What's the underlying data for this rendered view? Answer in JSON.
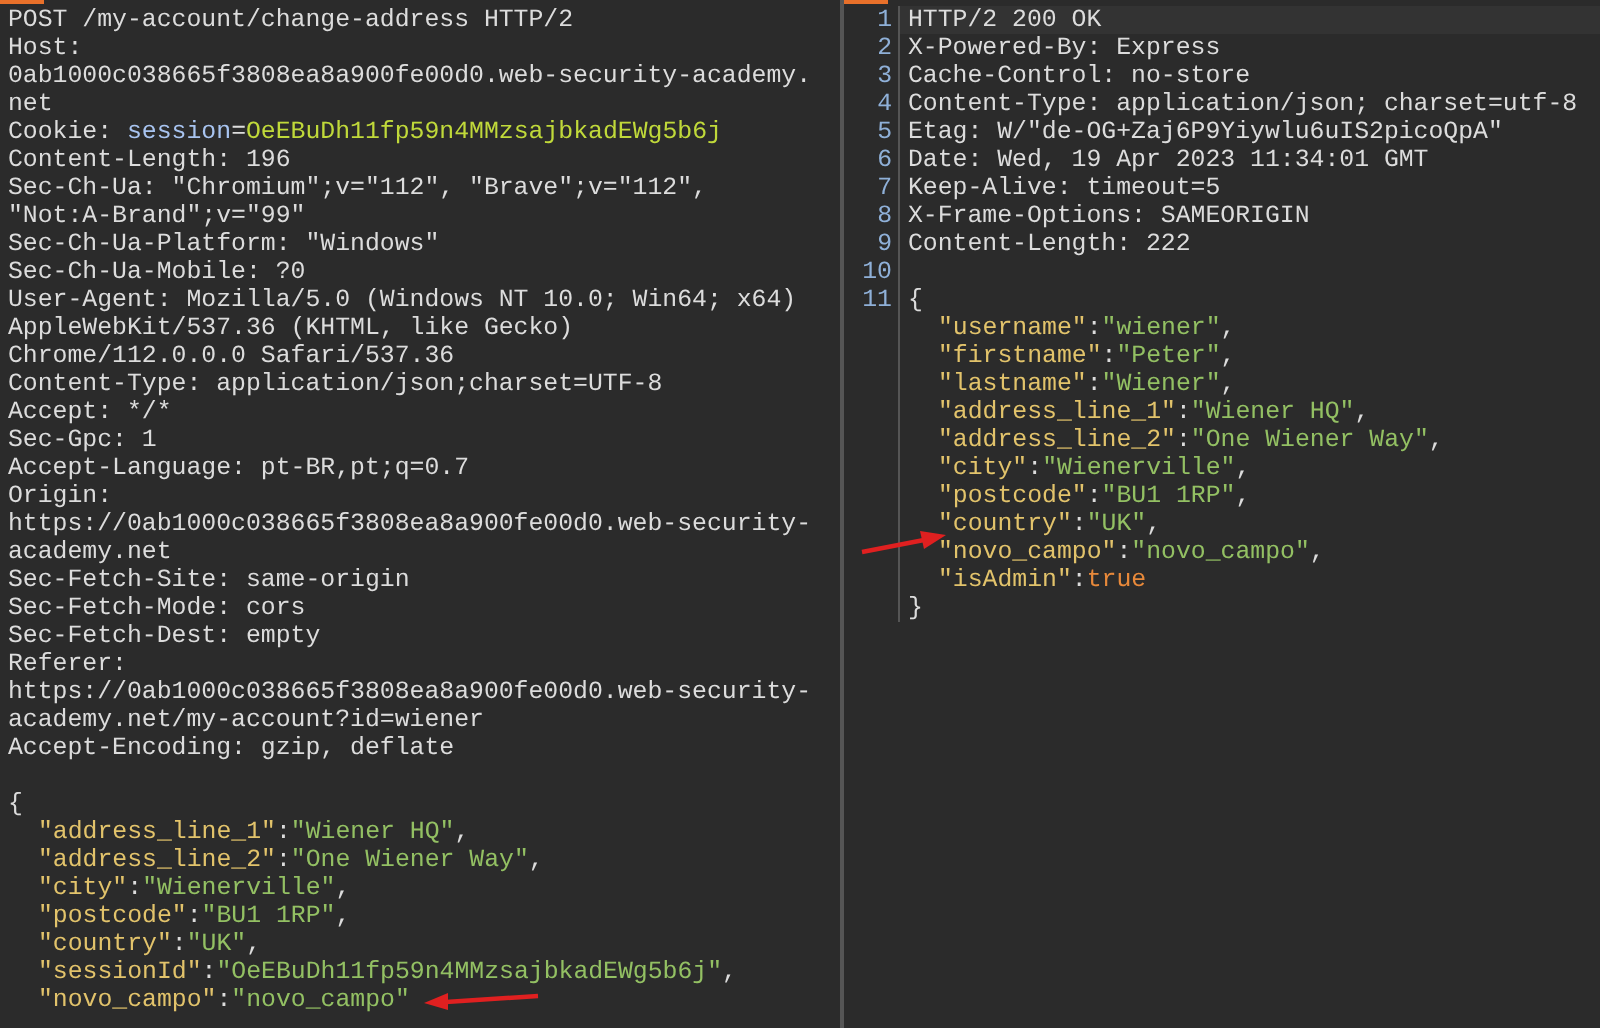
{
  "request": {
    "lines": [
      {
        "segments": [
          {
            "kind": "plain",
            "text": "POST /my-account/change-address HTTP/2"
          }
        ]
      },
      {
        "segments": [
          {
            "kind": "plain",
            "text": "Host:"
          }
        ]
      },
      {
        "segments": [
          {
            "kind": "plain",
            "text": "0ab1000c038665f3808ea8a900fe00d0.web-security-academy."
          }
        ]
      },
      {
        "segments": [
          {
            "kind": "plain",
            "text": "net"
          }
        ]
      },
      {
        "segments": [
          {
            "kind": "plain",
            "text": "Cookie: "
          },
          {
            "kind": "cookie_name",
            "text": "session"
          },
          {
            "kind": "plain",
            "text": "="
          },
          {
            "kind": "cookie_value",
            "text": "OeEBuDh11fp59n4MMzsajbkadEWg5b6j"
          }
        ]
      },
      {
        "segments": [
          {
            "kind": "plain",
            "text": "Content-Length: 196"
          }
        ]
      },
      {
        "segments": [
          {
            "kind": "plain",
            "text": "Sec-Ch-Ua: \"Chromium\";v=\"112\", \"Brave\";v=\"112\","
          }
        ]
      },
      {
        "segments": [
          {
            "kind": "plain",
            "text": "\"Not:A-Brand\";v=\"99\""
          }
        ]
      },
      {
        "segments": [
          {
            "kind": "plain",
            "text": "Sec-Ch-Ua-Platform: \"Windows\""
          }
        ]
      },
      {
        "segments": [
          {
            "kind": "plain",
            "text": "Sec-Ch-Ua-Mobile: ?0"
          }
        ]
      },
      {
        "segments": [
          {
            "kind": "plain",
            "text": "User-Agent: Mozilla/5.0 (Windows NT 10.0; Win64; x64)"
          }
        ]
      },
      {
        "segments": [
          {
            "kind": "plain",
            "text": "AppleWebKit/537.36 (KHTML, like Gecko)"
          }
        ]
      },
      {
        "segments": [
          {
            "kind": "plain",
            "text": "Chrome/112.0.0.0 Safari/537.36"
          }
        ]
      },
      {
        "segments": [
          {
            "kind": "plain",
            "text": "Content-Type: application/json;charset=UTF-8"
          }
        ]
      },
      {
        "segments": [
          {
            "kind": "plain",
            "text": "Accept: */*"
          }
        ]
      },
      {
        "segments": [
          {
            "kind": "plain",
            "text": "Sec-Gpc: 1"
          }
        ]
      },
      {
        "segments": [
          {
            "kind": "plain",
            "text": "Accept-Language: pt-BR,pt;q=0.7"
          }
        ]
      },
      {
        "segments": [
          {
            "kind": "plain",
            "text": "Origin:"
          }
        ]
      },
      {
        "segments": [
          {
            "kind": "plain",
            "text": "https://0ab1000c038665f3808ea8a900fe00d0.web-security-"
          }
        ]
      },
      {
        "segments": [
          {
            "kind": "plain",
            "text": "academy.net"
          }
        ]
      },
      {
        "segments": [
          {
            "kind": "plain",
            "text": "Sec-Fetch-Site: same-origin"
          }
        ]
      },
      {
        "segments": [
          {
            "kind": "plain",
            "text": "Sec-Fetch-Mode: cors"
          }
        ]
      },
      {
        "segments": [
          {
            "kind": "plain",
            "text": "Sec-Fetch-Dest: empty"
          }
        ]
      },
      {
        "segments": [
          {
            "kind": "plain",
            "text": "Referer:"
          }
        ]
      },
      {
        "segments": [
          {
            "kind": "plain",
            "text": "https://0ab1000c038665f3808ea8a900fe00d0.web-security-"
          }
        ]
      },
      {
        "segments": [
          {
            "kind": "plain",
            "text": "academy.net/my-account?id=wiener"
          }
        ]
      },
      {
        "segments": [
          {
            "kind": "plain",
            "text": "Accept-Encoding: gzip, deflate"
          }
        ]
      },
      {
        "gap_before": true,
        "segments": [
          {
            "kind": "plain",
            "text": "{"
          }
        ]
      },
      {
        "indent": true,
        "segments": [
          {
            "kind": "key",
            "text": "\"address_line_1\""
          },
          {
            "kind": "plain",
            "text": ":"
          },
          {
            "kind": "string",
            "text": "\"Wiener HQ\""
          },
          {
            "kind": "plain",
            "text": ","
          }
        ]
      },
      {
        "indent": true,
        "segments": [
          {
            "kind": "key",
            "text": "\"address_line_2\""
          },
          {
            "kind": "plain",
            "text": ":"
          },
          {
            "kind": "string",
            "text": "\"One Wiener Way\""
          },
          {
            "kind": "plain",
            "text": ","
          }
        ]
      },
      {
        "indent": true,
        "segments": [
          {
            "kind": "key",
            "text": "\"city\""
          },
          {
            "kind": "plain",
            "text": ":"
          },
          {
            "kind": "string",
            "text": "\"Wienerville\""
          },
          {
            "kind": "plain",
            "text": ","
          }
        ]
      },
      {
        "indent": true,
        "segments": [
          {
            "kind": "key",
            "text": "\"postcode\""
          },
          {
            "kind": "plain",
            "text": ":"
          },
          {
            "kind": "string",
            "text": "\"BU1 1RP\""
          },
          {
            "kind": "plain",
            "text": ","
          }
        ]
      },
      {
        "indent": true,
        "segments": [
          {
            "kind": "key",
            "text": "\"country\""
          },
          {
            "kind": "plain",
            "text": ":"
          },
          {
            "kind": "string",
            "text": "\"UK\""
          },
          {
            "kind": "plain",
            "text": ","
          }
        ]
      },
      {
        "indent": true,
        "segments": [
          {
            "kind": "key",
            "text": "\"sessionId\""
          },
          {
            "kind": "plain",
            "text": ":"
          },
          {
            "kind": "string",
            "text": "\"OeEBuDh11fp59n4MMzsajbkadEWg5b6j\""
          },
          {
            "kind": "plain",
            "text": ","
          }
        ]
      },
      {
        "indent": true,
        "arrow": true,
        "segments": [
          {
            "kind": "key",
            "text": "\"novo_campo\""
          },
          {
            "kind": "plain",
            "text": ":"
          },
          {
            "kind": "string",
            "text": "\"novo_campo\""
          }
        ]
      }
    ]
  },
  "response": {
    "lines": [
      {
        "number": "1",
        "segments": [
          {
            "kind": "plain",
            "text": "HTTP/2 200 OK"
          }
        ]
      },
      {
        "number": "2",
        "segments": [
          {
            "kind": "plain",
            "text": "X-Powered-By: Express"
          }
        ]
      },
      {
        "number": "3",
        "segments": [
          {
            "kind": "plain",
            "text": "Cache-Control: no-store"
          }
        ]
      },
      {
        "number": "4",
        "segments": [
          {
            "kind": "plain",
            "text": "Content-Type: application/json; charset=utf-8"
          }
        ]
      },
      {
        "number": "5",
        "segments": [
          {
            "kind": "plain",
            "text": "Etag: W/\"de-OG+Zaj6P9Yiywlu6uIS2picoQpA\""
          }
        ]
      },
      {
        "number": "6",
        "segments": [
          {
            "kind": "plain",
            "text": "Date: Wed, 19 Apr 2023 11:34:01 GMT"
          }
        ]
      },
      {
        "number": "7",
        "segments": [
          {
            "kind": "plain",
            "text": "Keep-Alive: timeout=5"
          }
        ]
      },
      {
        "number": "8",
        "segments": [
          {
            "kind": "plain",
            "text": "X-Frame-Options: SAMEORIGIN"
          }
        ]
      },
      {
        "number": "9",
        "segments": [
          {
            "kind": "plain",
            "text": "Content-Length: 222"
          }
        ]
      },
      {
        "number": "10"
      },
      {
        "number": "11",
        "segments": [
          {
            "kind": "plain",
            "text": "{"
          }
        ]
      },
      {
        "indent": true,
        "segments": [
          {
            "kind": "key",
            "text": "\"username\""
          },
          {
            "kind": "plain",
            "text": ":"
          },
          {
            "kind": "string",
            "text": "\"wiener\""
          },
          {
            "kind": "plain",
            "text": ","
          }
        ]
      },
      {
        "indent": true,
        "segments": [
          {
            "kind": "key",
            "text": "\"firstname\""
          },
          {
            "kind": "plain",
            "text": ":"
          },
          {
            "kind": "string",
            "text": "\"Peter\""
          },
          {
            "kind": "plain",
            "text": ","
          }
        ]
      },
      {
        "indent": true,
        "segments": [
          {
            "kind": "key",
            "text": "\"lastname\""
          },
          {
            "kind": "plain",
            "text": ":"
          },
          {
            "kind": "string",
            "text": "\"Wiener\""
          },
          {
            "kind": "plain",
            "text": ","
          }
        ]
      },
      {
        "indent": true,
        "segments": [
          {
            "kind": "key",
            "text": "\"address_line_1\""
          },
          {
            "kind": "plain",
            "text": ":"
          },
          {
            "kind": "string",
            "text": "\"Wiener HQ\""
          },
          {
            "kind": "plain",
            "text": ","
          }
        ]
      },
      {
        "indent": true,
        "segments": [
          {
            "kind": "key",
            "text": "\"address_line_2\""
          },
          {
            "kind": "plain",
            "text": ":"
          },
          {
            "kind": "string",
            "text": "\"One Wiener Way\""
          },
          {
            "kind": "plain",
            "text": ","
          }
        ]
      },
      {
        "indent": true,
        "segments": [
          {
            "kind": "key",
            "text": "\"city\""
          },
          {
            "kind": "plain",
            "text": ":"
          },
          {
            "kind": "string",
            "text": "\"Wienerville\""
          },
          {
            "kind": "plain",
            "text": ","
          }
        ]
      },
      {
        "indent": true,
        "segments": [
          {
            "kind": "key",
            "text": "\"postcode\""
          },
          {
            "kind": "plain",
            "text": ":"
          },
          {
            "kind": "string",
            "text": "\"BU1 1RP\""
          },
          {
            "kind": "plain",
            "text": ","
          }
        ]
      },
      {
        "indent": true,
        "segments": [
          {
            "kind": "key",
            "text": "\"country\""
          },
          {
            "kind": "plain",
            "text": ":"
          },
          {
            "kind": "string",
            "text": "\"UK\""
          },
          {
            "kind": "plain",
            "text": ","
          }
        ]
      },
      {
        "indent": true,
        "arrow": true,
        "segments": [
          {
            "kind": "key",
            "text": "\"novo_campo\""
          },
          {
            "kind": "plain",
            "text": ":"
          },
          {
            "kind": "string",
            "text": "\"novo_campo\""
          },
          {
            "kind": "plain",
            "text": ","
          }
        ]
      },
      {
        "indent": true,
        "segments": [
          {
            "kind": "key",
            "text": "\"isAdmin\""
          },
          {
            "kind": "plain",
            "text": ":"
          },
          {
            "kind": "literal",
            "text": "true"
          }
        ]
      },
      {
        "segments": [
          {
            "kind": "plain",
            "text": "}"
          }
        ]
      }
    ]
  }
}
